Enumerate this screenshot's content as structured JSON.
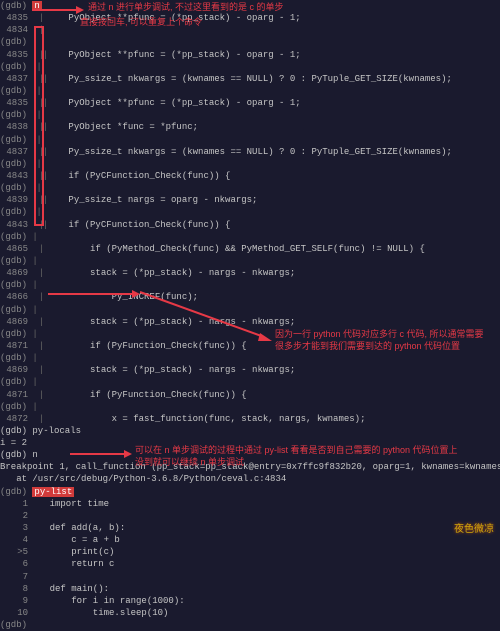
{
  "top_cmd": "n",
  "ann_top": "通过 n 进行单步调试, 不过这里看到的是 c 的单步",
  "ann_enter": "直接按回车, 可以重复上个命令",
  "gdb_prompt": "(gdb)",
  "lines": [
    {
      "no": "4835",
      "g1": "|",
      "g2": "",
      "code": "    PyObject **pfunc = (*pp_stack) - oparg - 1;"
    },
    {
      "no": "4834",
      "g1": "|",
      "g2": "",
      "code": ""
    },
    {
      "no": "",
      "g1": "|",
      "g2": "",
      "code": ""
    },
    {
      "no": "4835",
      "g1": "|",
      "g2": "|",
      "code": "    PyObject **pfunc = (*pp_stack) - oparg - 1;"
    },
    {
      "no": "",
      "g1": "|",
      "g2": "|",
      "code": ""
    },
    {
      "no": "4837",
      "g1": "|",
      "g2": "|",
      "code": "    Py_ssize_t nkwargs = (kwnames == NULL) ? 0 : PyTuple_GET_SIZE(kwnames);"
    },
    {
      "no": "",
      "g1": "|",
      "g2": "|",
      "code": ""
    },
    {
      "no": "4835",
      "g1": "|",
      "g2": "|",
      "code": "    PyObject **pfunc = (*pp_stack) - oparg - 1;"
    },
    {
      "no": "",
      "g1": "|",
      "g2": "|",
      "code": ""
    },
    {
      "no": "4838",
      "g1": "|",
      "g2": "|",
      "code": "    PyObject *func = *pfunc;"
    },
    {
      "no": "",
      "g1": "|",
      "g2": "|",
      "code": ""
    },
    {
      "no": "4837",
      "g1": "|",
      "g2": "|",
      "code": "    Py_ssize_t nkwargs = (kwnames == NULL) ? 0 : PyTuple_GET_SIZE(kwnames);"
    },
    {
      "no": "",
      "g1": "|",
      "g2": "|",
      "code": ""
    },
    {
      "no": "4843",
      "g1": "|",
      "g2": "|",
      "code": "    if (PyCFunction_Check(func)) {"
    },
    {
      "no": "",
      "g1": "|",
      "g2": "|",
      "code": ""
    },
    {
      "no": "4839",
      "g1": "|",
      "g2": "|",
      "code": "    Py_ssize_t nargs = oparg - nkwargs;"
    },
    {
      "no": "",
      "g1": "|",
      "g2": "|",
      "code": ""
    },
    {
      "no": "4843",
      "g1": "|",
      "g2": "|",
      "code": "    if (PyCFunction_Check(func)) {"
    },
    {
      "no": "",
      "g1": "|",
      "g2": "",
      "code": ""
    },
    {
      "no": "4865",
      "g1": "|",
      "g2": "",
      "code": "        if (PyMethod_Check(func) && PyMethod_GET_SELF(func) != NULL) {"
    },
    {
      "no": "",
      "g1": "|",
      "g2": "",
      "code": ""
    },
    {
      "no": "4869",
      "g1": "|",
      "g2": "",
      "code": "        stack = (*pp_stack) - nargs - nkwargs;"
    },
    {
      "no": "",
      "g1": "|",
      "g2": "",
      "code": ""
    },
    {
      "no": "4866",
      "g1": "|",
      "g2": "",
      "code": "            Py_INCREF(func);"
    },
    {
      "no": "",
      "g1": "|",
      "g2": "",
      "code": ""
    },
    {
      "no": "4869",
      "g1": "|",
      "g2": "",
      "code": "        stack = (*pp_stack) - nargs - nkwargs;"
    },
    {
      "no": "",
      "g1": "|",
      "g2": "",
      "code": ""
    },
    {
      "no": "4871",
      "g1": "|",
      "g2": "",
      "code": "        if (PyFunction_Check(func)) {"
    },
    {
      "no": "",
      "g1": "|",
      "g2": "",
      "code": ""
    },
    {
      "no": "4869",
      "g1": "|",
      "g2": "",
      "code": "        stack = (*pp_stack) - nargs - nkwargs;"
    },
    {
      "no": "",
      "g1": "|",
      "g2": "",
      "code": ""
    },
    {
      "no": "4871",
      "g1": "|",
      "g2": "",
      "code": "        if (PyFunction_Check(func)) {"
    },
    {
      "no": "",
      "g1": "|",
      "g2": "",
      "code": ""
    },
    {
      "no": "4872",
      "g1": "|",
      "g2": "",
      "code": "            x = fast_function(func, stack, nargs, kwnames);"
    }
  ],
  "ann_mid_1": "因为一行 python 代码对应多行 c 代码,  所以通常需要",
  "ann_mid_2": "很多步才能到我们需要到达的 python 代码位置",
  "after_block": [
    "(gdb) py-locals",
    "i = 2",
    "(gdb) n",
    "",
    "Breakpoint 1, call_function (pp_stack=pp_stack@entry=0x7ffc9f832b20, oparg=1, kwnames=kwnames@entry=0x0)",
    "   at /usr/src/debug/Python-3.6.8/Python/ceval.c:4834"
  ],
  "pylist_cmd": "py-list",
  "ann_pylist_1": "可以在 n 单步调试的过程中通过 py-list 看看是否到自己需要的 python 代码位置上",
  "ann_pylist_2": "没到就可以继续 n 单步调试",
  "py_listing": [
    {
      "n": "  1",
      "c": "    import time"
    },
    {
      "n": "  2",
      "c": ""
    },
    {
      "n": "  3",
      "c": "    def add(a, b):"
    },
    {
      "n": "  4",
      "c": "        c = a + b"
    },
    {
      "n": " >5",
      "c": "        print(c)"
    },
    {
      "n": "  6",
      "c": "        return c"
    },
    {
      "n": "  7",
      "c": ""
    },
    {
      "n": "  8",
      "c": "    def main():"
    },
    {
      "n": "  9",
      "c": "        for i in range(1000):"
    },
    {
      "n": " 10",
      "c": "            time.sleep(10)"
    }
  ],
  "last_prompt": "(gdb)",
  "watermark": "夜色微凉"
}
